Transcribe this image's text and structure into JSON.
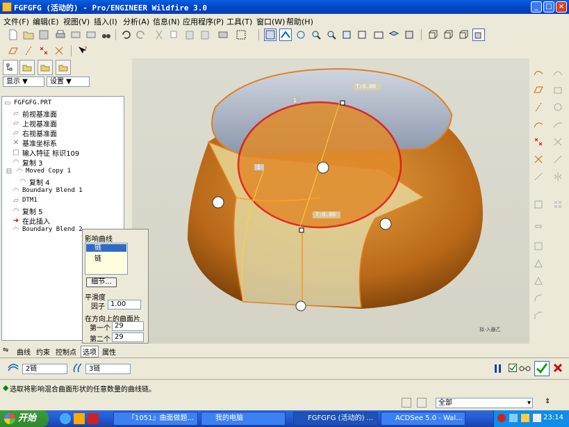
{
  "window": {
    "title": "FGFGFG (活动的) - Pro/ENGINEER Wildfire 3.0",
    "buttons": [
      "_",
      "□",
      "×"
    ]
  },
  "menu": [
    "文件(F)",
    "编辑(E)",
    "视图(V)",
    "插入(I)",
    "分析(A)",
    "信息(N)",
    "应用程序(P)",
    "工具(T)",
    "窗口(W)",
    "帮助(H)"
  ],
  "panel": {
    "show_label": "显示 ▼",
    "settings_label": "设置 ▼"
  },
  "tree": [
    "FGFGFG.PRT",
    "前视基准面",
    "上视基准面",
    "右视基准面",
    "基准坐标系",
    "输入特征 标识109",
    "复制 3",
    "Moved Copy 1",
    "复制 4",
    "Boundary Blend 1",
    "DTM1",
    "复制 5",
    "在此插入",
    "Boundary Blend 2"
  ],
  "popup": {
    "title": "影响曲线",
    "items": [
      "链",
      "链"
    ],
    "detail_button": "细节...",
    "smoothness_label": "平滑度",
    "factor_label": "因子",
    "factor_value": "1.00",
    "patches_label": "在方向上的曲面片",
    "first_label": "第一个",
    "first_value": "29",
    "second_label": "第二个",
    "second_value": "29"
  },
  "viewport": {
    "label_top": "T:0.00",
    "label_mid": "T:0.00",
    "tag1": "1",
    "tag2": "1",
    "corner": "拟-入器乙"
  },
  "dashboard": {
    "tabs": [
      "曲线",
      "约束",
      "控制点",
      "选项",
      "属性"
    ],
    "active_tab": "选项",
    "chain1": "2链",
    "chain2": "3链"
  },
  "status_message": "选取将影响混合曲面形状的任意数量的曲线链。",
  "filter_value": "全部",
  "taskbar": {
    "start": "开始",
    "tasks": [
      "『1051』曲面做题...",
      "我的电脑",
      "FGFGFG (活动的) ...",
      "ACDSee 5.0 - Wal..."
    ],
    "clock": "23:14"
  }
}
